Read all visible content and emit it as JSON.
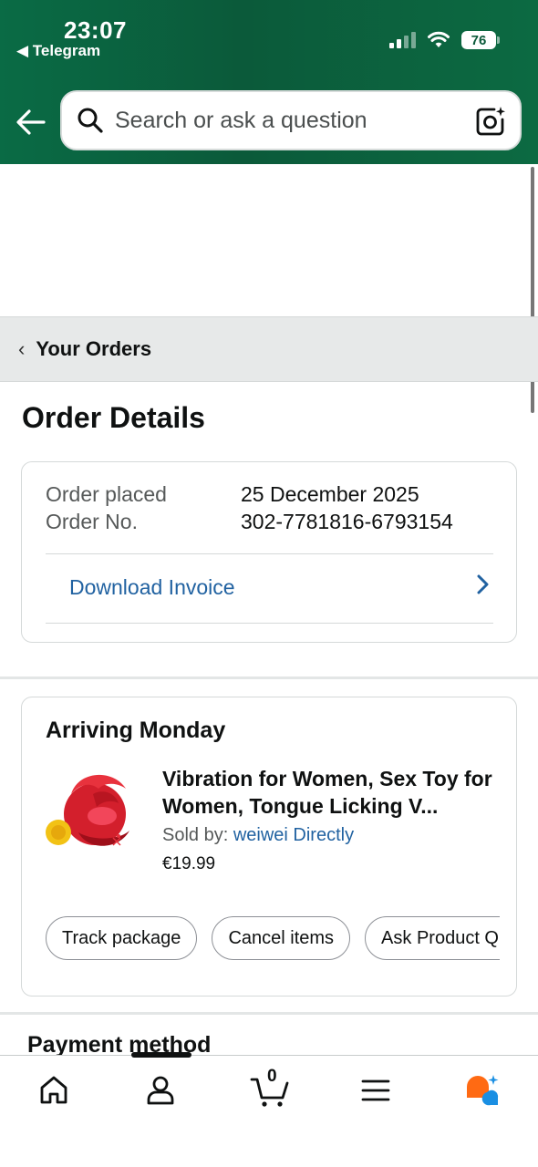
{
  "status_bar": {
    "time": "23:07",
    "back_app": "◀ Telegram",
    "battery": "76"
  },
  "search": {
    "placeholder": "Search or ask a question"
  },
  "breadcrumb": {
    "label": "Your Orders"
  },
  "page": {
    "title": "Order Details"
  },
  "order_info": {
    "placed_label": "Order placed",
    "placed_value": "25 December 2025",
    "number_label": "Order No.",
    "number_value": "302-7781816-6793154",
    "invoice_link": "Download Invoice"
  },
  "shipment": {
    "status": "Arriving Monday",
    "product_title": "Vibration for Women, Sex Toy for Women, Tongue Licking V...",
    "sold_by_label": "Sold by:",
    "seller": "weiwei Directly",
    "price": "€19.99",
    "actions": [
      "Track package",
      "Cancel items",
      "Ask Product Question"
    ]
  },
  "payment": {
    "heading": "Payment method"
  },
  "bottom_nav": {
    "items": [
      "home-icon",
      "account-icon",
      "cart-icon",
      "menu-icon",
      "rufus-icon"
    ],
    "cart_count": "0",
    "active_index": 1
  },
  "colors": {
    "header_green": "#0b5a3a",
    "link_blue": "#2162a1",
    "accent_orange": "#ff6a13",
    "accent_blue": "#1a8fe3"
  }
}
